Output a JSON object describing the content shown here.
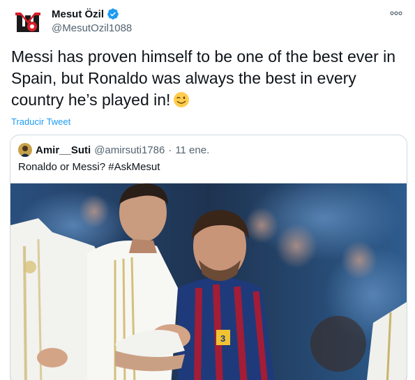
{
  "tweet": {
    "author": {
      "display_name": "Mesut Özil",
      "handle": "@MesutOzil1088",
      "verified": true,
      "avatar_icon": "m10-logo"
    },
    "text": "Messi has proven himself to be one of the best ever in Spain, but Ronaldo was always the best in every country he’s played in!",
    "emoji_icon": "winking-face-emoji",
    "translate_label": "Traducir Tweet",
    "more_icon": "more-dots-icon"
  },
  "quote": {
    "display_name": "Amir__Suti",
    "handle": "@amirsuti1786",
    "separator": "·",
    "date": "11 ene.",
    "text": "Ronaldo or Messi? #AskMesut",
    "media_icon": "football-players-photo"
  },
  "colors": {
    "text": "#0f1419",
    "secondary": "#536471",
    "link": "#1d9bf0",
    "border": "#cfd9de",
    "verified": "#1d9bf0"
  }
}
